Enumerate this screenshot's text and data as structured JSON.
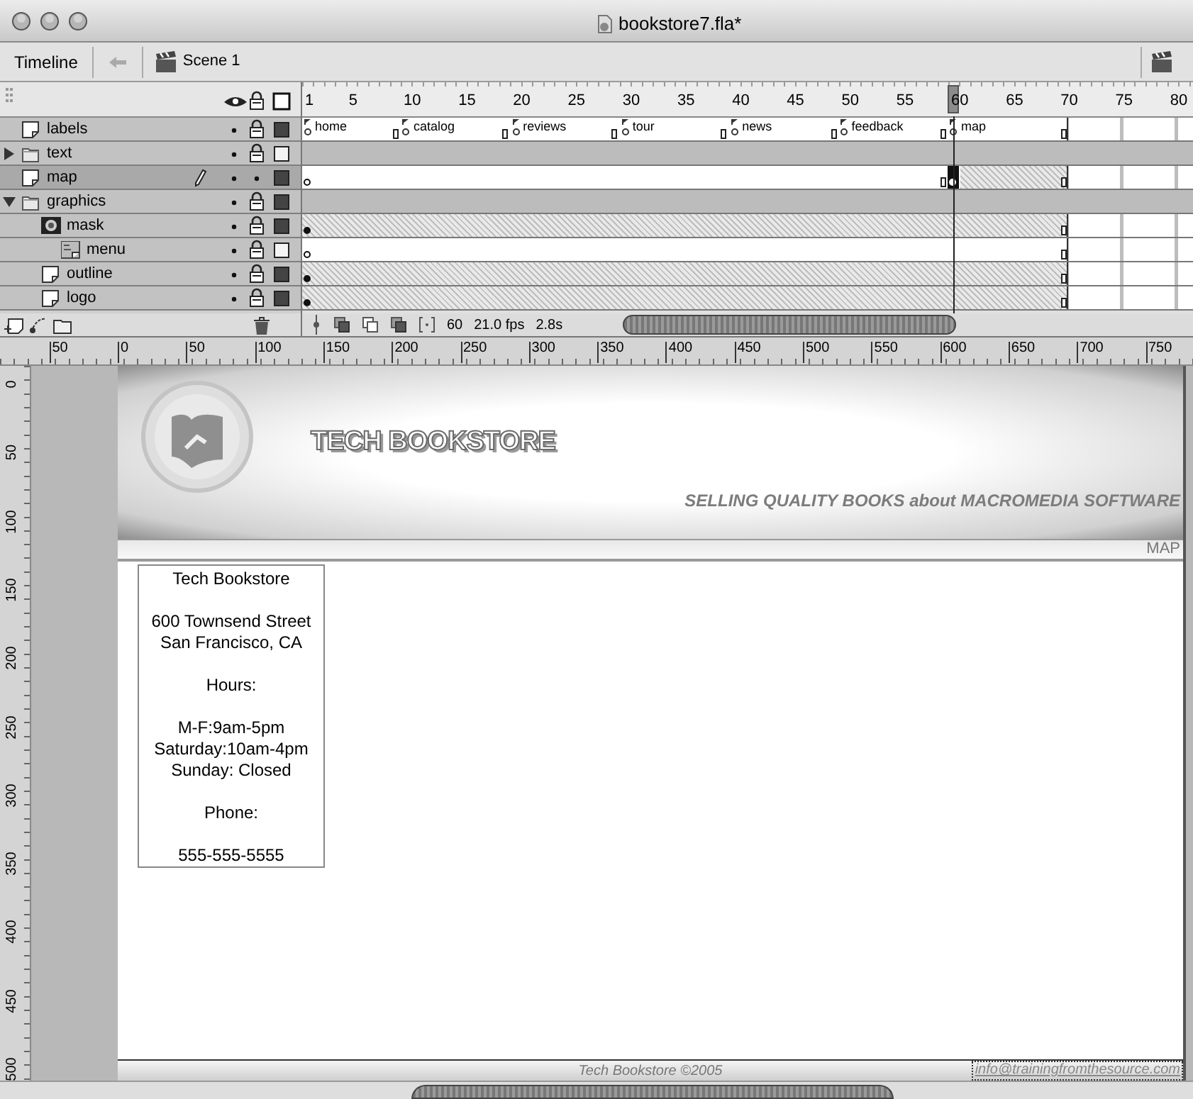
{
  "window": {
    "title": "bookstore7.fla*"
  },
  "toolbar": {
    "panel": "Timeline",
    "scene": "Scene 1"
  },
  "timeline": {
    "frame_numbers": [
      "1",
      "5",
      "10",
      "15",
      "20",
      "25",
      "30",
      "35",
      "40",
      "45",
      "50",
      "55",
      "60",
      "65",
      "70",
      "75",
      "80"
    ],
    "frame_labels": [
      "home",
      "catalog",
      "reviews",
      "tour",
      "news",
      "feedback",
      "map"
    ],
    "layers": [
      {
        "name": "labels",
        "kind": "layer",
        "track": {
          "kind": "labels"
        },
        "locked": true,
        "outline_filled": true,
        "selected": false
      },
      {
        "name": "text",
        "kind": "folder",
        "expanded": false,
        "track": {
          "kind": "none"
        },
        "locked": true,
        "outline_filled": false,
        "selected": false
      },
      {
        "name": "map",
        "kind": "layer",
        "track": {
          "kind": "split"
        },
        "locked": false,
        "outline_filled": true,
        "selected": true
      },
      {
        "name": "graphics",
        "kind": "folder",
        "expanded": true,
        "track": {
          "kind": "none"
        },
        "locked": true,
        "outline_filled": true,
        "selected": false,
        "children": [
          {
            "name": "mask",
            "kind": "mask",
            "track": {
              "kind": "filled"
            },
            "locked": true,
            "outline_filled": true,
            "selected": false,
            "children": [
              {
                "name": "menu",
                "kind": "masked",
                "track": {
                  "kind": "blank"
                },
                "locked": true,
                "outline_filled": false,
                "selected": false
              }
            ]
          },
          {
            "name": "outline",
            "kind": "layer",
            "track": {
              "kind": "filled"
            },
            "locked": true,
            "outline_filled": true,
            "selected": false
          },
          {
            "name": "logo",
            "kind": "layer",
            "track": {
              "kind": "filled"
            },
            "locked": true,
            "outline_filled": true,
            "selected": false
          }
        ]
      }
    ],
    "status": {
      "frame": "60",
      "rate": "21.0 fps",
      "time": "2.8s"
    }
  },
  "rulers": {
    "horizontal": [
      "50",
      "0",
      "50",
      "100",
      "150",
      "200",
      "250",
      "300",
      "350",
      "400",
      "450",
      "500",
      "550",
      "600",
      "650",
      "700",
      "750"
    ],
    "vertical": [
      "0",
      "50",
      "100",
      "150",
      "200",
      "250",
      "300",
      "350",
      "400",
      "450",
      "500"
    ]
  },
  "stage": {
    "banner_title": "TECH BOOKSTORE",
    "tagline": "SELLING QUALITY BOOKS about MACROMEDIA SOFTWARE",
    "section": "MAP",
    "address": [
      [
        "Tech Bookstore"
      ],
      [
        "600 Townsend Street",
        "San Francisco, CA"
      ],
      [
        "Hours:"
      ],
      [
        "M-F:9am-5pm",
        "Saturday:10am-4pm",
        "Sunday: Closed"
      ],
      [
        "Phone:"
      ],
      [
        "555-555-5555"
      ]
    ],
    "footer": "Tech Bookstore ©2005",
    "email": "info@trainingfromthesource.com"
  }
}
